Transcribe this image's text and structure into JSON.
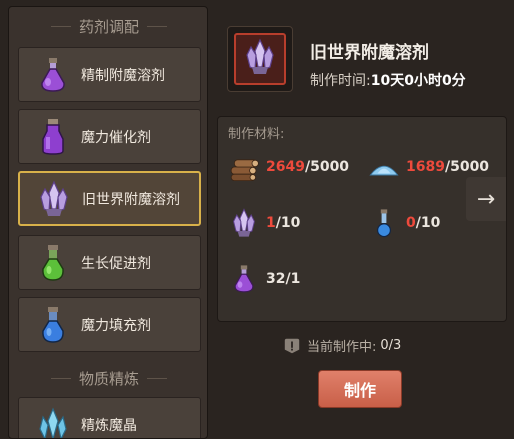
{
  "left": {
    "section1_title": "药剂调配",
    "section2_title": "物质精炼",
    "recipes": [
      {
        "label": "精制附魔溶剂",
        "icon": "purple-potion-icon"
      },
      {
        "label": "魔力催化剂",
        "icon": "purple-flask-icon"
      },
      {
        "label": "旧世界附魔溶剂",
        "icon": "crystal-icon"
      },
      {
        "label": "生长促进剂",
        "icon": "green-potion-icon"
      },
      {
        "label": "魔力填充剂",
        "icon": "blue-potion-icon"
      }
    ],
    "refine": [
      {
        "label": "精炼魔晶",
        "icon": "blue-crystal-icon"
      }
    ]
  },
  "detail": {
    "title": "旧世界附魔溶剂",
    "time_label": "制作时间:",
    "time_value": "10天0小时0分",
    "materials_title": "制作材料:",
    "materials": [
      {
        "icon": "wood-logs-icon",
        "have": "2649",
        "need": "/5000",
        "short": true
      },
      {
        "icon": "blue-powder-icon",
        "have": "1689",
        "need": "/5000",
        "short": true
      },
      {
        "icon": "crystal-icon",
        "have": "1",
        "need": "/10",
        "short": true
      },
      {
        "icon": "blue-vial-icon",
        "have": "0",
        "need": "/10",
        "short": true
      },
      {
        "icon": "purple-potion-icon",
        "have": "32",
        "need": "/1",
        "short": false
      }
    ],
    "next_arrow": "→",
    "current_label": "当前制作中:",
    "current_value": "0/3",
    "make_label": "制作"
  },
  "colors": {
    "shortfall": "#ee4a3c",
    "selected_border": "#d8b14a",
    "button": "#d46f58"
  }
}
